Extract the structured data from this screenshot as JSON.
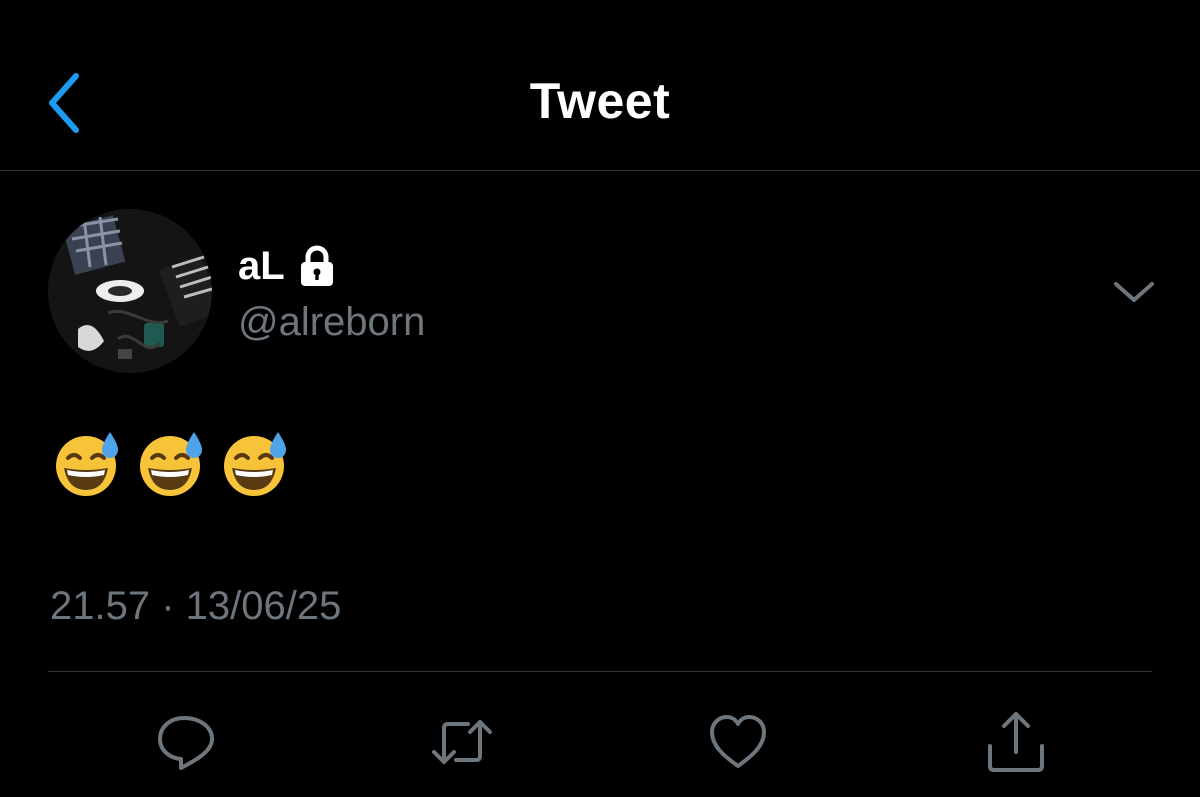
{
  "header": {
    "title": "Tweet",
    "back_icon": "chevron-left-icon",
    "accent_color": "#1d9bf0"
  },
  "tweet": {
    "author": {
      "display_name": "aL",
      "handle": "@alreborn",
      "protected_icon": "lock-icon"
    },
    "text": "😅 😅 😅",
    "emojis": [
      "😅",
      "😅",
      "😅"
    ],
    "timestamp": "21.57 · 13/06/25",
    "menu_icon": "chevron-down-icon"
  },
  "actions": [
    {
      "name": "reply",
      "icon": "reply-icon"
    },
    {
      "name": "retweet",
      "icon": "retweet-icon"
    },
    {
      "name": "like",
      "icon": "heart-icon"
    },
    {
      "name": "share",
      "icon": "share-icon"
    }
  ],
  "colors": {
    "background": "#000000",
    "text_primary": "#ffffff",
    "text_secondary": "#6e767d",
    "divider": "#2f3336",
    "icon": "#6e767d"
  }
}
